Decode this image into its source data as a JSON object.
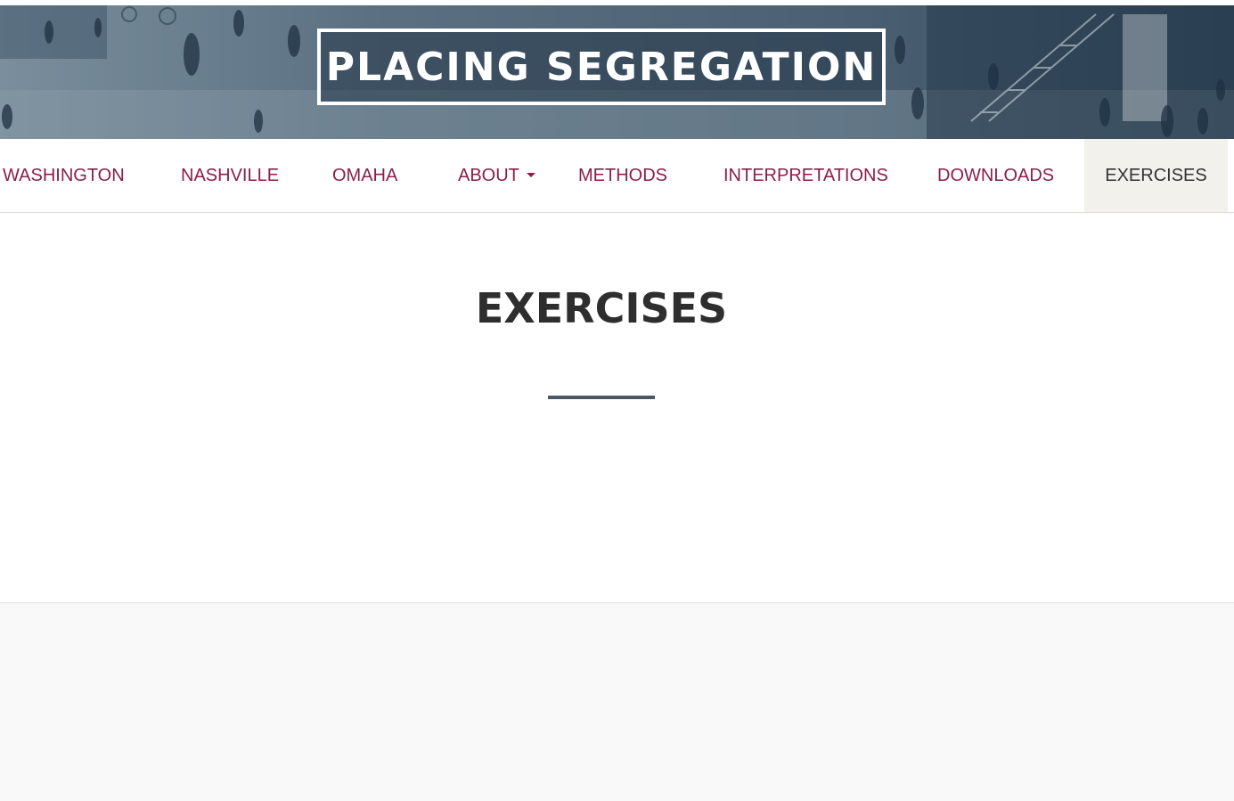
{
  "site": {
    "title": "PLACING SEGREGATION"
  },
  "nav": {
    "items": [
      {
        "label": "WASHINGTON"
      },
      {
        "label": "NASHVILLE"
      },
      {
        "label": "OMAHA"
      },
      {
        "label": "ABOUT",
        "dropdown": true
      },
      {
        "label": "METHODS"
      },
      {
        "label": "INTERPRETATIONS"
      },
      {
        "label": "DOWNLOADS"
      },
      {
        "label": "EXERCISES",
        "active": true
      }
    ]
  },
  "main": {
    "heading": "EXERCISES"
  },
  "colors": {
    "nav_link": "#8a1f4a",
    "nav_active_bg": "#f3f1ec",
    "banner_overlay": "#243748",
    "footer_bg": "#f9f9f9"
  },
  "icons": {
    "about_dropdown": "caret-down-icon"
  }
}
